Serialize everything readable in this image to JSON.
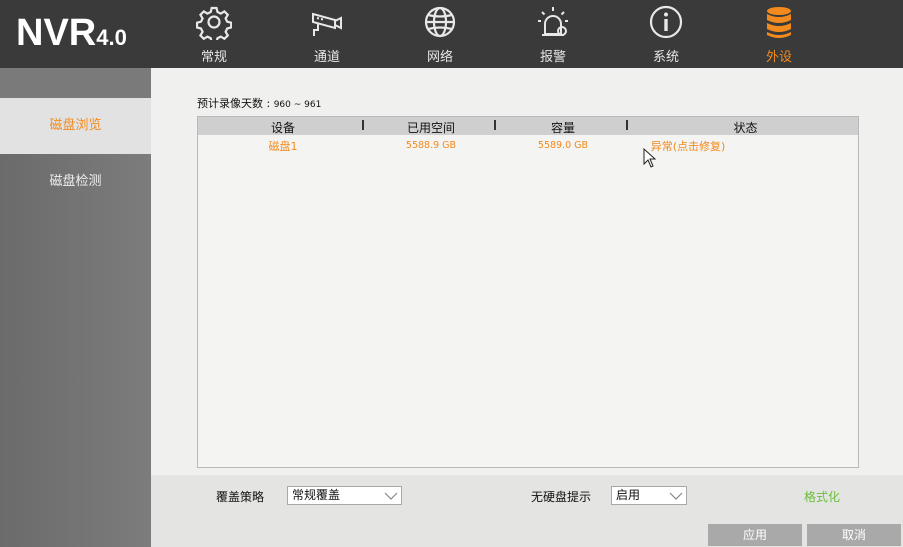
{
  "app": {
    "logo_main": "NVR",
    "logo_version": "4.0"
  },
  "nav": [
    {
      "label": "常规",
      "icon": "gear-icon"
    },
    {
      "label": "通道",
      "icon": "camera-icon"
    },
    {
      "label": "网络",
      "icon": "globe-icon"
    },
    {
      "label": "报警",
      "icon": "alarm-icon"
    },
    {
      "label": "系统",
      "icon": "info-icon"
    },
    {
      "label": "外设",
      "icon": "storage-icon",
      "active": true
    }
  ],
  "sidebar": {
    "items": [
      {
        "label": "磁盘浏览",
        "active": true
      },
      {
        "label": "磁盘检测"
      }
    ]
  },
  "content": {
    "estimate_label": "预计录像天数 : ",
    "estimate_value": "960 ~ 961",
    "table": {
      "headers": [
        "设备",
        "已用空间",
        "容量",
        "状态"
      ],
      "rows": [
        {
          "device": "磁盘1",
          "used": "5588.9 GB",
          "capacity": "5589.0 GB",
          "status": "异常(点击修复)"
        }
      ]
    }
  },
  "bottom": {
    "overwrite_label": "覆盖策略",
    "overwrite_value": "常规覆盖",
    "no_disk_label": "无硬盘提示",
    "no_disk_value": "启用",
    "format_label": "格式化",
    "apply_label": "应用",
    "cancel_label": "取消"
  },
  "colors": {
    "accent": "#f28a1e",
    "format_green": "#6bbf3a",
    "topbar": "#3a3a3a"
  }
}
